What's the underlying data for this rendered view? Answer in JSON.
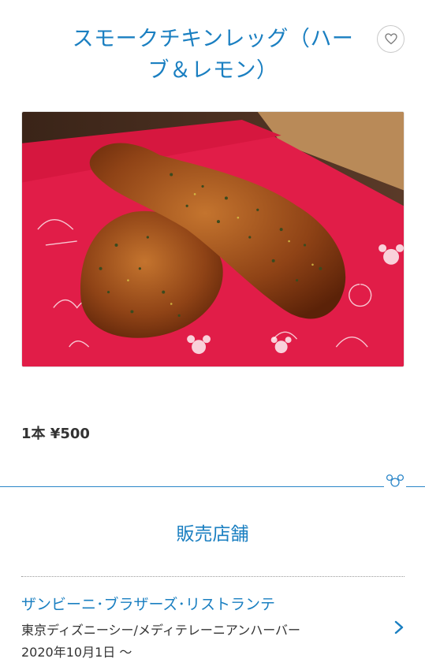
{
  "product": {
    "title_line1": "スモークチキンレッグ（ハー",
    "title_line2": "ブ＆レモン）",
    "price": "1本 ¥500"
  },
  "sales_section": {
    "heading": "販売店舗",
    "store": {
      "name": "ザンビーニ･ブラザーズ･リストランテ",
      "area": "東京ディズニーシー/メディテレーニアンハーバー",
      "date": "2020年10月1日 〜"
    }
  },
  "icons": {
    "favorite": "heart-icon",
    "store_link": "chevron-right-icon",
    "divider": "mickey-icon"
  },
  "colors": {
    "accent": "#1a7fc1",
    "text": "#333333"
  }
}
